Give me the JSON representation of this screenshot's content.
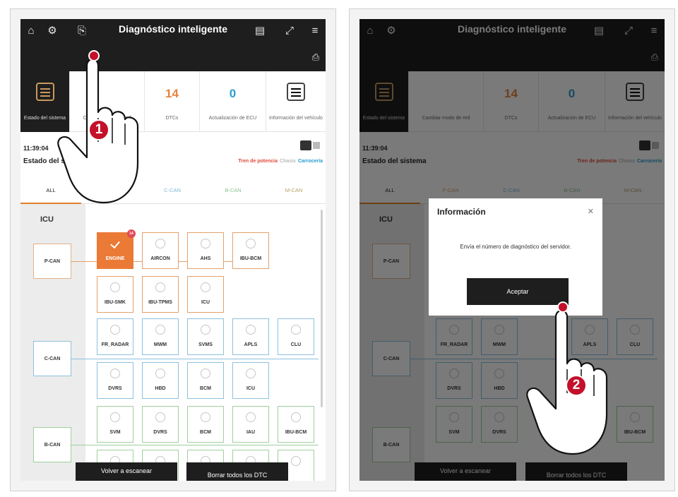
{
  "screens": [
    {
      "topbar": {
        "title": "Diagnóstico inteligente"
      },
      "tiles": [
        {
          "label": "Estado del sistema"
        },
        {
          "label": "Cambiar modo de red"
        },
        {
          "number": "14",
          "label": "DTCs",
          "color": "#e8843e"
        },
        {
          "number": "0",
          "label": "Actualización de ECU",
          "color": "#2a9ccf"
        },
        {
          "label": "Información del vehículo"
        }
      ],
      "time": "11:39:04",
      "status_title": "Estado del sistema",
      "legend": {
        "a": "Tren de potencia",
        "b": "Chasis",
        "c": "Carrocería"
      },
      "tabs": [
        "ALL",
        "P-CAN",
        "C-CAN",
        "B-CAN",
        "M-CAN"
      ],
      "icu_label": "ICU",
      "buses": [
        "P-CAN",
        "C-CAN",
        "B-CAN"
      ],
      "pcan_row1": [
        "ENGINE",
        "AIRCON",
        "AHS",
        "IBU-BCM"
      ],
      "pcan_badge": "14",
      "pcan_row2": [
        "IBU-SMK",
        "IBU-TPMS",
        "ICU"
      ],
      "ccan_row1": [
        "FR_RADAR",
        "MWM",
        "SVMS",
        "APLS",
        "CLU"
      ],
      "ccan_row2": [
        "DVRS",
        "HBD",
        "BCM",
        "ICU"
      ],
      "bcan_row1": [
        "SVM",
        "DVRS",
        "BCM",
        "IAU",
        "IBU-BCM"
      ],
      "buttons": {
        "rescan": "Volver a escanear",
        "clear": "Borrar todos los DTC"
      },
      "step": "1"
    },
    {
      "dialog": {
        "title": "Información",
        "message": "Envía el número de diagnóstico del servidor.",
        "accept": "Aceptar"
      },
      "step": "2"
    }
  ],
  "colors": {
    "topbar": "#1e1e1e",
    "active_module": "#ea7a35",
    "pcan": "#e3a16d",
    "ccan": "#8dc1dd",
    "bcan": "#9fd09c",
    "marker": "#c4102a"
  }
}
